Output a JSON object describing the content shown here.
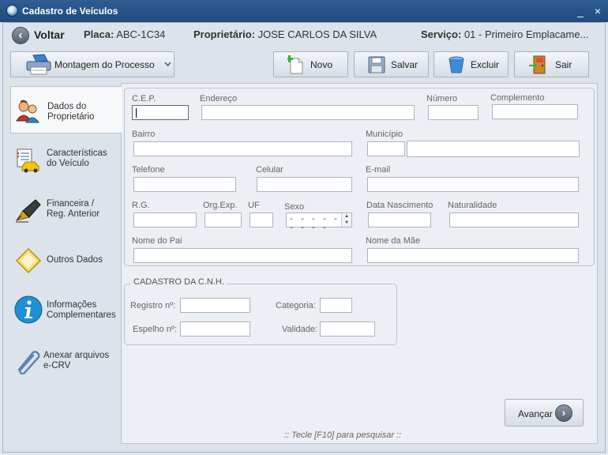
{
  "window": {
    "title": "Cadastro de Veículos",
    "minimize": "_",
    "close": "×"
  },
  "infobar": {
    "back_label": "Voltar",
    "placa_label": "Placa:",
    "placa_value": "ABC-1C34",
    "proprietario_label": "Proprietário:",
    "proprietario_value": "JOSE CARLOS DA SILVA",
    "servico_label": "Serviço:",
    "servico_value": "01 - Primeiro Emplacame..."
  },
  "toolbar": {
    "montagem_label": "Montagem do Processo",
    "novo_label": "Novo",
    "salvar_label": "Salvar",
    "excluir_label": "Excluir",
    "sair_label": "Sair"
  },
  "sidebar": {
    "items": [
      {
        "line1": "Dados do",
        "line2": "Proprietário",
        "icon": "people-icon"
      },
      {
        "line1": "Características",
        "line2": "do Veículo",
        "icon": "car-list-icon"
      },
      {
        "line1": "Financeira /",
        "line2": "Reg. Anterior",
        "icon": "pen-icon"
      },
      {
        "line1": "Outros Dados",
        "line2": "",
        "icon": "diamond-icon"
      },
      {
        "line1": "Informações",
        "line2": "Complementares",
        "icon": "info-icon"
      },
      {
        "line1": "Anexar arquivos",
        "line2": "e-CRV",
        "icon": "paperclip-icon"
      }
    ]
  },
  "form": {
    "cep_label": "C.E.P.",
    "cep_value": "",
    "endereco_label": "Endereço",
    "endereco_value": "",
    "numero_label": "Número",
    "numero_value": "",
    "complemento_label": "Complemento",
    "complemento_value": "",
    "bairro_label": "Bairro",
    "bairro_value": "",
    "municipio_label": "Município",
    "municipio_code": "",
    "municipio_name": "",
    "telefone_label": "Telefone",
    "telefone_value": "",
    "celular_label": "Celular",
    "celular_value": "",
    "email_label": "E-mail",
    "email_value": "",
    "rg_label": "R.G.",
    "rg_value": "",
    "orgexp_label": "Org.Exp.",
    "orgexp_value": "",
    "uf_label": "UF",
    "uf_value": "",
    "sexo_label": "Sexo",
    "sexo_value": "- - - - - - - - - -",
    "nascimento_label": "Data Nascimento",
    "nascimento_value": "",
    "naturalidade_label": "Naturalidade",
    "naturalidade_value": "",
    "pai_label": "Nome do Pai",
    "pai_value": "",
    "mae_label": "Nome da Mãe",
    "mae_value": ""
  },
  "cnh": {
    "title": "CADASTRO DA C.N.H.",
    "registro_label": "Registro nº:",
    "registro_value": "",
    "categoria_label": "Categoria:",
    "categoria_value": "",
    "espelho_label": "Espelho nº:",
    "espelho_value": "",
    "validade_label": "Validade:",
    "validade_value": ""
  },
  "footer": {
    "avancar_label": "Avançar",
    "hint": "::  Tecle [F10] para pesquisar  ::"
  }
}
